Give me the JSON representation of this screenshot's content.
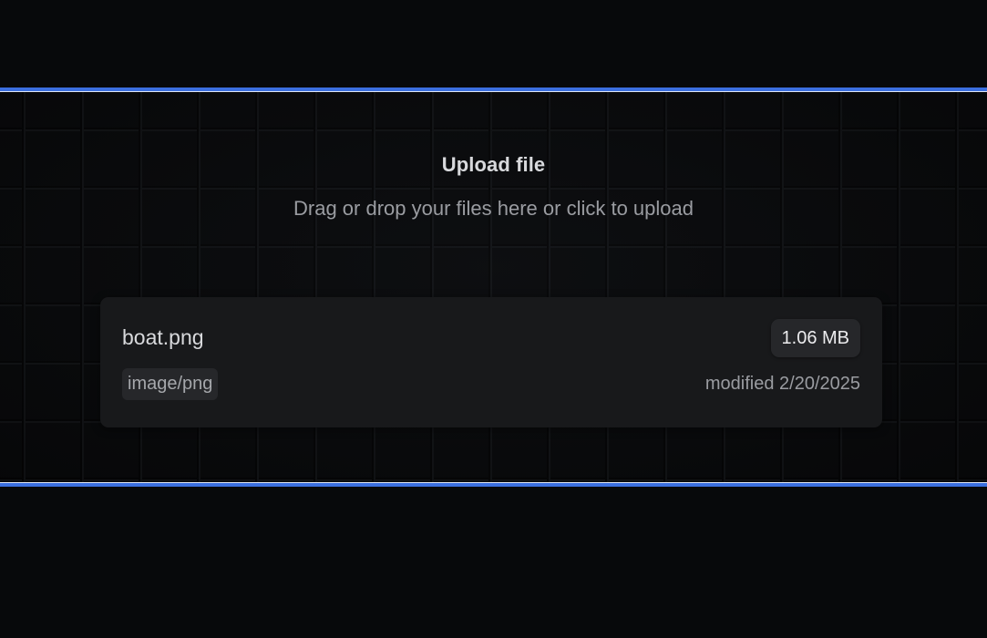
{
  "upload": {
    "title": "Upload file",
    "subtitle": "Drag or drop your files here or click to upload"
  },
  "file": {
    "name": "boat.png",
    "size": "1.06 MB",
    "type": "image/png",
    "modified": "modified 2/20/2025"
  },
  "colors": {
    "page_background": "#07090b",
    "zone_border": "#3b6fe0",
    "card_background": "#18191b",
    "badge_background": "#26272a"
  }
}
